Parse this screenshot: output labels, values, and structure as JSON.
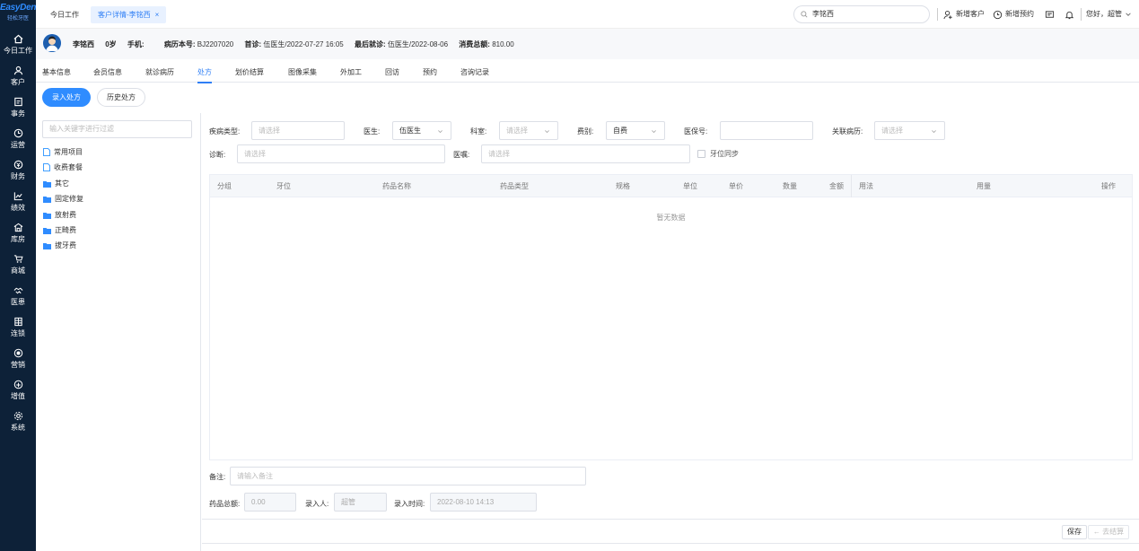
{
  "brand": {
    "name": "EasyDent",
    "sub": "轻松牙医"
  },
  "nav": [
    {
      "label": "今日工作",
      "icon": "home-icon"
    },
    {
      "label": "客户",
      "icon": "user-icon"
    },
    {
      "label": "事务",
      "icon": "task-icon"
    },
    {
      "label": "运营",
      "icon": "clock-icon"
    },
    {
      "label": "财务",
      "icon": "money-icon"
    },
    {
      "label": "绩效",
      "icon": "chart-icon"
    },
    {
      "label": "库房",
      "icon": "warehouse-icon"
    },
    {
      "label": "商城",
      "icon": "cart-icon"
    },
    {
      "label": "医患",
      "icon": "handshake-icon"
    },
    {
      "label": "连锁",
      "icon": "chain-icon"
    },
    {
      "label": "营销",
      "icon": "marketing-icon"
    },
    {
      "label": "增值",
      "icon": "gift-icon"
    },
    {
      "label": "系统",
      "icon": "gear-icon"
    }
  ],
  "topbar": {
    "home_tab": "今日工作",
    "current_tab": "客户详情-李铭西",
    "close": "×",
    "search_value": "李铭西",
    "new_customer": "新增客户",
    "new_appointment": "新增预约",
    "greeting": "您好，超管"
  },
  "patient": {
    "name": "李铭西",
    "age": "0岁",
    "phone_label": "手机:",
    "phone": "",
    "record_label": "病历本号:",
    "record": "BJ2207020",
    "first_label": "首诊:",
    "first": "伍医生/2022-07-27 16:05",
    "last_label": "最后就诊:",
    "last": "伍医生/2022-08-06",
    "total_label": "消费总额:",
    "total": "810.00"
  },
  "subtabs": [
    "基本信息",
    "会员信息",
    "就诊病历",
    "处方",
    "划价结算",
    "图像采集",
    "外加工",
    "回访",
    "预约",
    "咨询记录"
  ],
  "buttons": {
    "enter_rx": "录入处方",
    "history_rx": "历史处方"
  },
  "tree": {
    "filter_placeholder": "输入关键字进行过滤",
    "items": [
      "常用项目",
      "收费套餐",
      "其它",
      "固定修复",
      "放射费",
      "正畸费",
      "拔牙费"
    ]
  },
  "form": {
    "disease_type_label": "疾病类型:",
    "disease_type_ph": "请选择",
    "doctor_label": "医生:",
    "doctor_value": "伍医生",
    "dept_label": "科室:",
    "dept_ph": "请选择",
    "fee_label": "费别:",
    "fee_value": "自费",
    "insurance_label": "医保号:",
    "related_label": "关联病历:",
    "related_ph": "请选择",
    "diag_label": "诊断:",
    "diag_ph": "请选择",
    "advice_label": "医嘱:",
    "advice_ph": "请选择",
    "tooth_sync": "牙位同步"
  },
  "table": {
    "columns": [
      "分组",
      "牙位",
      "药品名称",
      "药品类型",
      "规格",
      "单位",
      "单价",
      "数量",
      "金额",
      "用法",
      "用量",
      "操作"
    ],
    "empty": "暂无数据"
  },
  "footer": {
    "note_label": "备注:",
    "note_ph": "请输入备注",
    "total_label": "药品总额:",
    "total_value": "0.00",
    "entry_label": "录入人:",
    "entry_value": "超管",
    "time_label": "录入时间:",
    "time_value": "2022-08-10 14:13",
    "save": "保存",
    "to_settle": "← 去结算"
  },
  "colors": {
    "accent": "#2f8cff",
    "nav_bg": "#0d2138"
  }
}
